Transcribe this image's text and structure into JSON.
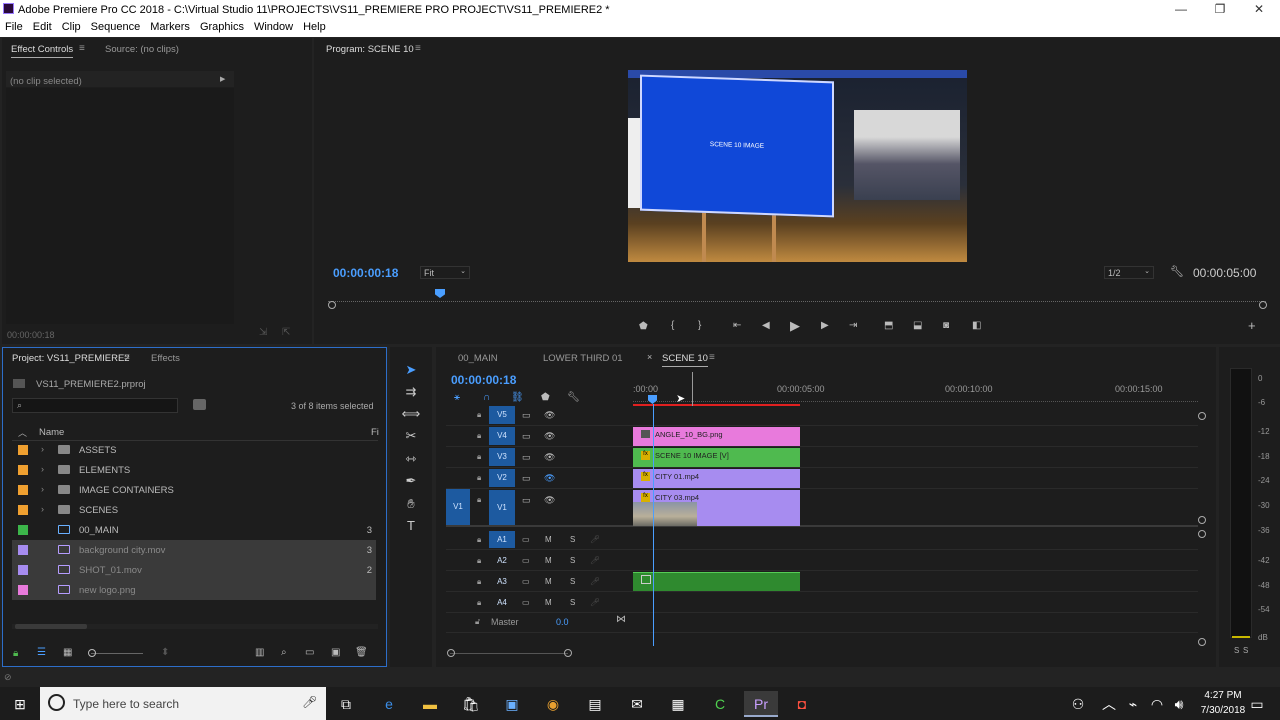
{
  "window": {
    "title": "Adobe Premiere Pro CC 2018 - C:\\Virtual Studio 11\\PROJECTS\\VS11_PREMIERE PRO PROJECT\\VS11_PREMIERE2 *",
    "minimize": "—",
    "maximize": "❐",
    "close": "✕"
  },
  "menu": [
    "File",
    "Edit",
    "Clip",
    "Sequence",
    "Markers",
    "Graphics",
    "Window",
    "Help"
  ],
  "effect_controls": {
    "tab": "Effect Controls",
    "tab2": "Source: (no clips)",
    "no_clip": "(no clip selected)",
    "timecode": "00:00:00:18"
  },
  "program": {
    "tab": "Program: SCENE 10",
    "screen_label": "SCENE 10 IMAGE",
    "timecode": "00:00:00:18",
    "fit": "Fit",
    "resolution": "1/2",
    "duration": "00:00:05:00"
  },
  "project": {
    "tab": "Project: VS11_PREMIERE2",
    "tab2": "Effects",
    "file": "VS11_PREMIERE2.prproj",
    "selected": "3 of 8 items selected",
    "col_name": "Name",
    "col_f": "Fi",
    "items": [
      {
        "label": "ASSETS",
        "color": "#f0a030",
        "type": "folder",
        "count": ""
      },
      {
        "label": "ELEMENTS",
        "color": "#f0a030",
        "type": "folder",
        "count": ""
      },
      {
        "label": "IMAGE CONTAINERS",
        "color": "#f0a030",
        "type": "folder",
        "count": ""
      },
      {
        "label": "SCENES",
        "color": "#f0a030",
        "type": "folder",
        "count": ""
      },
      {
        "label": "00_MAIN",
        "color": "#3cb64a",
        "type": "sequence",
        "count": "3"
      },
      {
        "label": "background city.mov",
        "color": "#a78cf0",
        "type": "clip",
        "count": "3"
      },
      {
        "label": "SHOT_01.mov",
        "color": "#a78cf0",
        "type": "clip",
        "count": "2"
      },
      {
        "label": "new logo.png",
        "color": "#e87adc",
        "type": "image",
        "count": ""
      }
    ]
  },
  "timeline": {
    "tabs": [
      "00_MAIN",
      "LOWER THIRD 01",
      "SCENE 10"
    ],
    "timecode": "00:00:00:18",
    "ruler": [
      ":00:00",
      "00:00:05:00",
      "00:00:10:00",
      "00:00:15:00"
    ],
    "video_tracks": [
      "V5",
      "V4",
      "V3",
      "V2",
      "V1"
    ],
    "audio_tracks": [
      "A1",
      "A2",
      "A3",
      "A4"
    ],
    "master": "Master",
    "master_val": "0.0",
    "src_v": "V1",
    "src_a": "A1",
    "m": "M",
    "s": "S",
    "clips": {
      "v4": "ANGLE_10_BG.png",
      "v3": "SCENE 10 IMAGE [V]",
      "v2": "CITY 01.mp4",
      "v1": "CITY 03.mp4"
    }
  },
  "meter": {
    "labels": [
      "0",
      "-6",
      "-12",
      "-18",
      "-24",
      "-30",
      "-36",
      "-42",
      "-48",
      "-54",
      "dB"
    ],
    "s1": "S",
    "s2": "S"
  },
  "taskbar": {
    "search": "Type here to search",
    "time": "4:27 PM",
    "date": "7/30/2018"
  },
  "colors": {
    "accent": "#4a9eff",
    "video_pink": "#e87adc",
    "video_green": "#4fba4f",
    "video_purple": "#a78cf0"
  }
}
